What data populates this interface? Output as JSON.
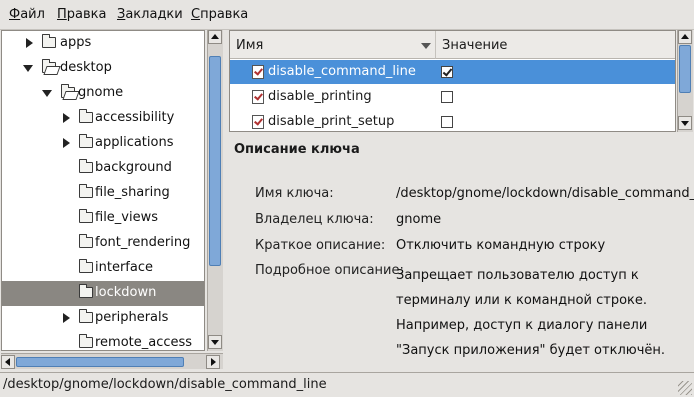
{
  "menubar": {
    "items": [
      {
        "u": "Ф",
        "rest": "айл"
      },
      {
        "u": "П",
        "rest": "равка"
      },
      {
        "u": "З",
        "rest": "акладки"
      },
      {
        "u": "С",
        "rest": "правка"
      }
    ]
  },
  "tree": {
    "items": [
      {
        "label": "apps",
        "expander": "closed"
      },
      {
        "label": "desktop",
        "expander": "open"
      },
      {
        "label": "gnome",
        "expander": "open"
      },
      {
        "label": "accessibility",
        "expander": "closed"
      },
      {
        "label": "applications",
        "expander": "closed"
      },
      {
        "label": "background",
        "expander": "none"
      },
      {
        "label": "file_sharing",
        "expander": "none"
      },
      {
        "label": "file_views",
        "expander": "none"
      },
      {
        "label": "font_rendering",
        "expander": "none"
      },
      {
        "label": "interface",
        "expander": "none"
      },
      {
        "label": "lockdown",
        "expander": "none",
        "selected": true
      },
      {
        "label": "peripherals",
        "expander": "closed"
      },
      {
        "label": "remote_access",
        "expander": "none"
      }
    ]
  },
  "key_list": {
    "columns": {
      "name": "Имя",
      "value": "Значение"
    },
    "rows": [
      {
        "name": "disable_command_line",
        "checked": true,
        "selected": true
      },
      {
        "name": "disable_printing",
        "checked": false,
        "selected": false
      },
      {
        "name": "disable_print_setup",
        "checked": false,
        "selected": false
      }
    ]
  },
  "description": {
    "title": "Описание ключа",
    "key_name_label": "Имя ключа:",
    "key_name_value": "/desktop/gnome/lockdown/disable_command_line",
    "owner_label": "Владелец ключа:",
    "owner_value": "gnome",
    "short_label": "Краткое описание:",
    "short_value": "Отключить командную строку",
    "long_label": "Подробное описание:",
    "long_value": "Запрещает пользователю доступ к терминалу или к командной строке. Например, доступ к диалогу панели \"Запуск приложения\" будет отключён."
  },
  "status": {
    "path": "/desktop/gnome/lockdown/disable_command_line"
  },
  "colors": {
    "selection_blue": "#4a90d9",
    "tree_selection": "#8a8782",
    "window_bg": "#e6e4e1"
  }
}
